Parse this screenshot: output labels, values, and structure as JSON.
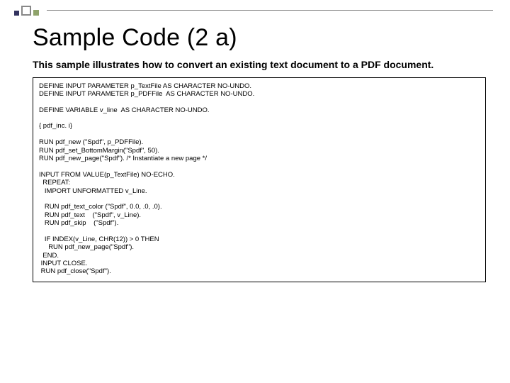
{
  "slide": {
    "title": "Sample Code (2 a)",
    "subtitle": "This sample illustrates how to convert an existing text document to a PDF document.",
    "code": "DEFINE INPUT PARAMETER p_TextFile AS CHARACTER NO-UNDO.\nDEFINE INPUT PARAMETER p_PDFFile  AS CHARACTER NO-UNDO.\n\nDEFINE VARIABLE v_line  AS CHARACTER NO-UNDO.\n\n{ pdf_inc. i}\n\nRUN pdf_new (\"Spdf\", p_PDFFile).\nRUN pdf_set_BottomMargin(\"Spdf\", 50).\nRUN pdf_new_page(\"Spdf\"). /* Instantiate a new page */\n\nINPUT FROM VALUE(p_TextFile) NO-ECHO.\n  REPEAT:\n   IMPORT UNFORMATTED v_Line.\n\n   RUN pdf_text_color (\"Spdf\", 0.0, .0, .0).\n   RUN pdf_text    (\"Spdf\", v_Line).\n   RUN pdf_skip    (\"Spdf\").\n\n   IF INDEX(v_Line, CHR(12)) > 0 THEN\n     RUN pdf_new_page(\"Spdf\").\n  END.\n INPUT CLOSE.\n RUN pdf_close(\"Spdf\")."
  }
}
